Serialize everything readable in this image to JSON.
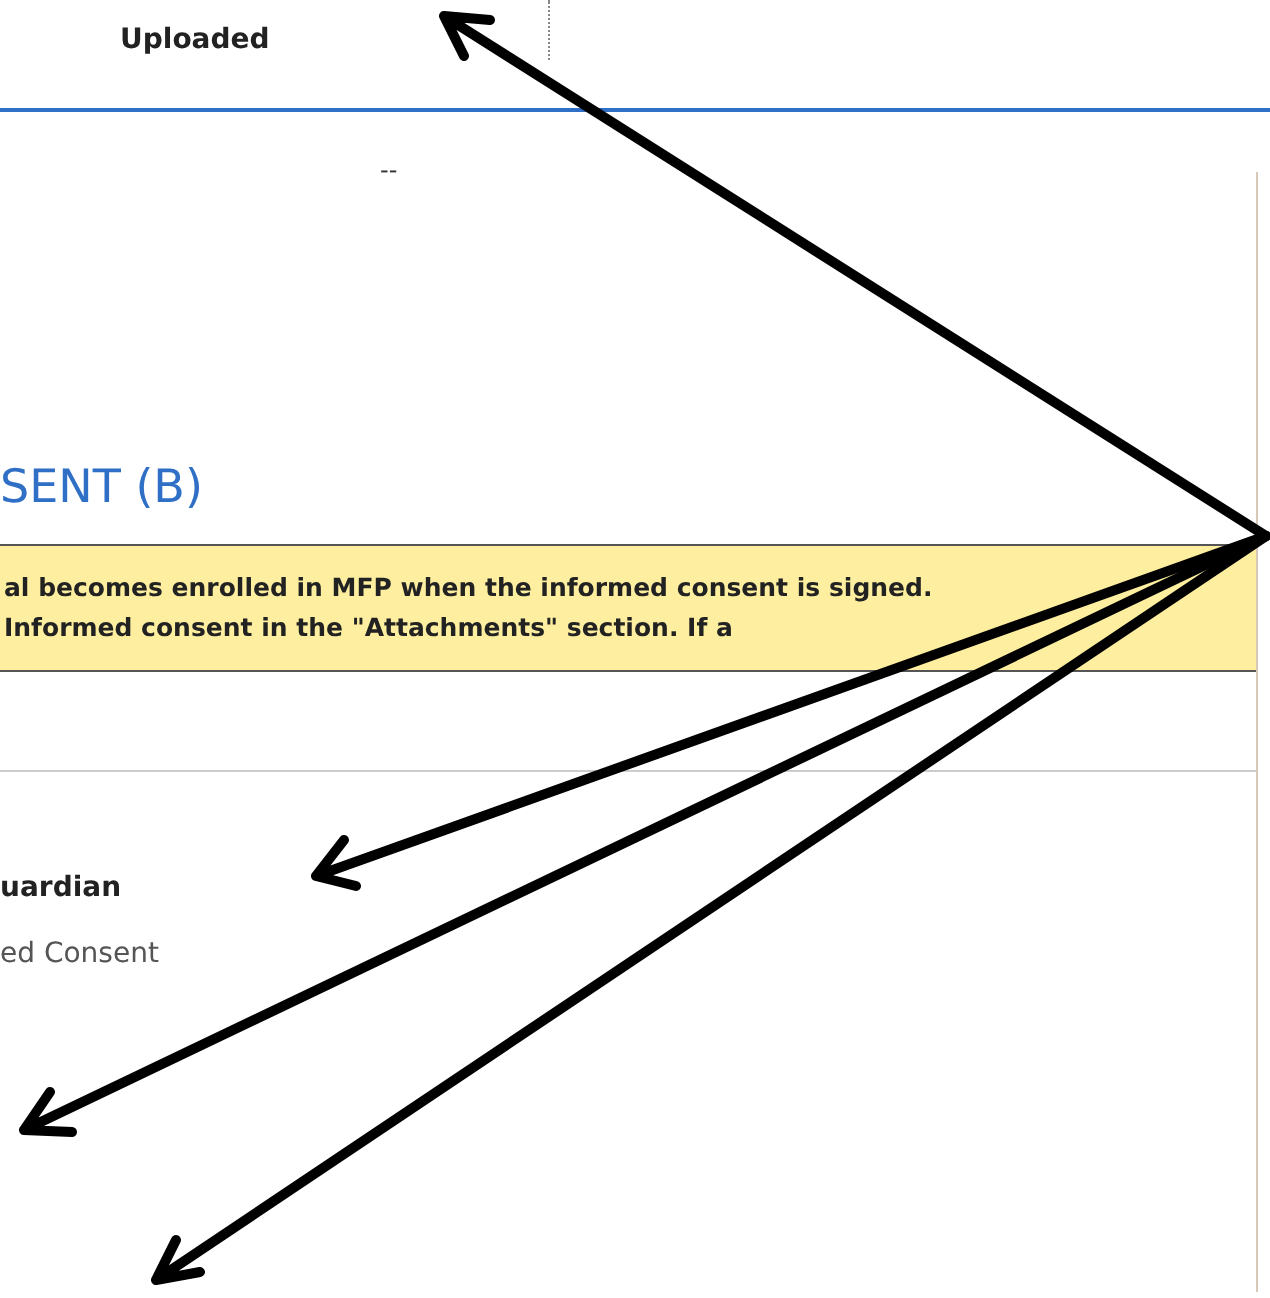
{
  "header": {
    "column_label": "Uploaded"
  },
  "row": {
    "value": "--"
  },
  "section": {
    "title": "SENT (B)",
    "notice": [
      "al becomes enrolled in MFP when the informed consent is signed.",
      "Informed consent in the \"Attachments\" section. If a"
    ]
  },
  "field": {
    "label": "uardian",
    "value": "ed Consent"
  }
}
